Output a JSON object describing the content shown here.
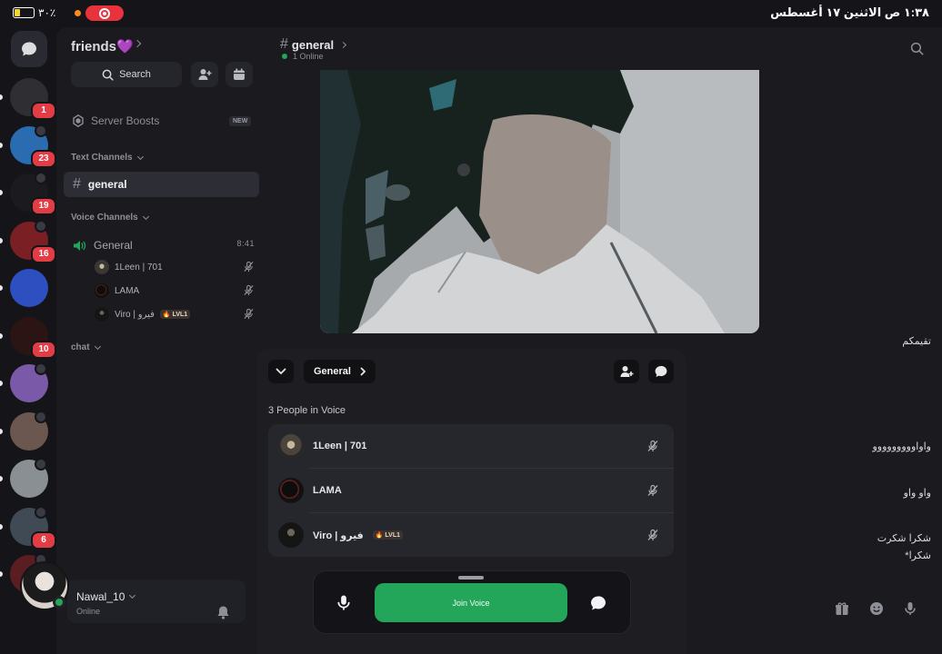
{
  "status_bar": {
    "battery_percent": "٣٠٪",
    "battery_level": 0.3,
    "time_date": "١:٣٨ ص   الاثنين ١٧ أغسطس"
  },
  "servers": [
    {
      "icon": "server-avatar-dark",
      "badge": "1",
      "color": "#2f2f33"
    },
    {
      "icon": "server-avatar-blue",
      "badge": "23",
      "color": "#2b6cb0"
    },
    {
      "icon": "server-avatar-sxa",
      "badge": "19",
      "color": "#1b1b1f"
    },
    {
      "icon": "server-avatar-red",
      "badge": "16",
      "color": "#7a1f23"
    },
    {
      "icon": "server-avatar-neon",
      "badge": "",
      "color": "#2d4fbf"
    },
    {
      "icon": "server-avatar-flame",
      "badge": "10",
      "color": "#2a1414"
    },
    {
      "icon": "server-avatar-rainbow",
      "badge": "",
      "color": "#7a5aa8"
    },
    {
      "icon": "server-avatar-photo",
      "badge": "",
      "color": "#6b5750"
    },
    {
      "icon": "server-avatar-people",
      "badge": "",
      "color": "#8a8f93"
    },
    {
      "icon": "server-avatar-portrait",
      "badge": "6",
      "color": "#3f4a55"
    },
    {
      "icon": "server-avatar-partial",
      "badge": "",
      "color": "#5a1d22"
    }
  ],
  "sidebar": {
    "guild_name": "friends💜",
    "search_label": "Search",
    "server_boosts_label": "Server Boosts",
    "new_tag": "NEW",
    "text_channels_label": "Text Channels",
    "selected_channel": "general",
    "voice_channels_label": "Voice Channels",
    "voice_channel": {
      "name": "General",
      "timer": "8:41",
      "users": [
        {
          "name": "1Leen | 701",
          "tag": ""
        },
        {
          "name": "LAMA",
          "tag": ""
        },
        {
          "name": "Viro | فيرو",
          "tag": "🔥 LVL1"
        }
      ]
    },
    "chat_category": "chat"
  },
  "user_panel": {
    "username": "Nawal_10",
    "status": "Online"
  },
  "main": {
    "channel_name": "general",
    "online_text": "1 Online",
    "messages": [
      "تقيمكم",
      "واواووووووووو",
      "واو واو",
      "شكرا شكرت",
      "شكرا*"
    ]
  },
  "voice_overlay": {
    "channel_button": "General",
    "people_count": "3 People in Voice",
    "participants": [
      {
        "name": "1Leen | 701",
        "tag": ""
      },
      {
        "name": "LAMA",
        "tag": ""
      },
      {
        "name": "Viro | فيرو",
        "tag": "🔥 LVL1"
      }
    ],
    "join_label": "Join Voice"
  }
}
